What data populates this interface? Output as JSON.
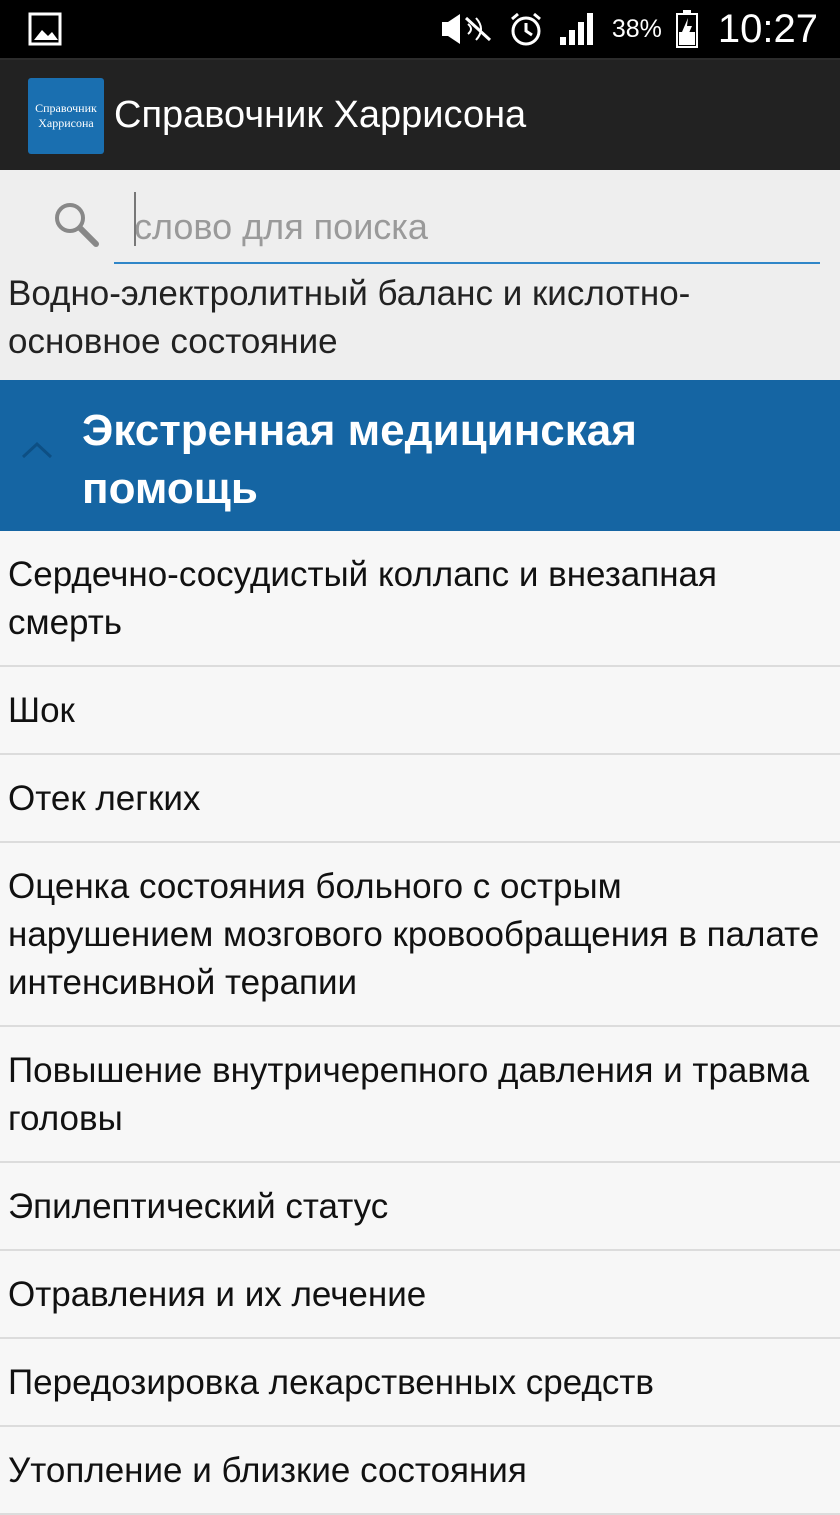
{
  "status_bar": {
    "battery_percent": "38%",
    "time": "10:27",
    "icons": [
      "image-icon",
      "mute-icon",
      "alarm-icon",
      "signal-icon",
      "battery-icon"
    ]
  },
  "app": {
    "logo_text_line1": "Справочник",
    "logo_text_line2": "Харрисона",
    "title": "Справочник Харрисона",
    "accent_color": "#1565a3"
  },
  "search": {
    "placeholder": "слово для поиска",
    "value": ""
  },
  "previous_group_text": "Водно-электролитный баланс и кислотно-основное состояние",
  "group": {
    "title": "Экстренная медицинская помощь",
    "expanded": true
  },
  "items": [
    "Сердечно-сосудистый коллапс и внезапная смерть",
    "Шок",
    "Отек легких",
    "Оценка состояния больного с острым нарушением мозгового кровообращения в палате интенсивной терапии",
    "Повышение внутричерепного давления и травма головы",
    "Эпилептический статус",
    "Отравления и их лечение",
    "Передозировка лекарственных средств",
    "Утопление и близкие состояния"
  ]
}
